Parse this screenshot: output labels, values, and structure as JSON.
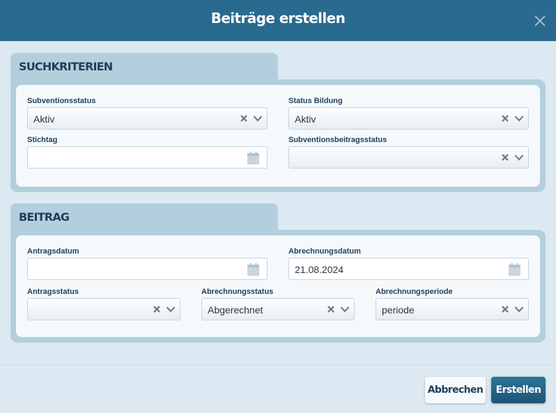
{
  "dialog": {
    "title": "Beiträge erstellen"
  },
  "suchkriterien": {
    "heading": "SUCHKRITERIEN",
    "subventionsstatus": {
      "label": "Subventionsstatus",
      "value": "Aktiv"
    },
    "status_bildung": {
      "label": "Status Bildung",
      "value": "Aktiv"
    },
    "stichtag": {
      "label": "Stichtag",
      "value": ""
    },
    "subventionsbeitragsstatus": {
      "label": "Subventionsbeitragsstatus",
      "value": ""
    }
  },
  "beitrag": {
    "heading": "BEITRAG",
    "antragsdatum": {
      "label": "Antragsdatum",
      "value": ""
    },
    "abrechnungsdatum": {
      "label": "Abrechnungsdatum",
      "value": "21.08.2024"
    },
    "antragsstatus": {
      "label": "Antragsstatus",
      "value": ""
    },
    "abrechnungsstatus": {
      "label": "Abrechnungsstatus",
      "value": "Abgerechnet"
    },
    "abrechnungsperiode": {
      "label": "Abrechnungsperiode",
      "value": "periode"
    }
  },
  "footer": {
    "cancel_label": "Abbrechen",
    "submit_label": "Erstellen"
  },
  "colors": {
    "header": "#2a6a8e",
    "panel": "#b3cfdd",
    "label": "#1e3f5a",
    "primary_button": "#1d5475"
  },
  "icons": {
    "close": "close-icon",
    "clear": "clear-x-icon",
    "dropdown": "chevron-down-icon",
    "date": "calendar-icon"
  }
}
